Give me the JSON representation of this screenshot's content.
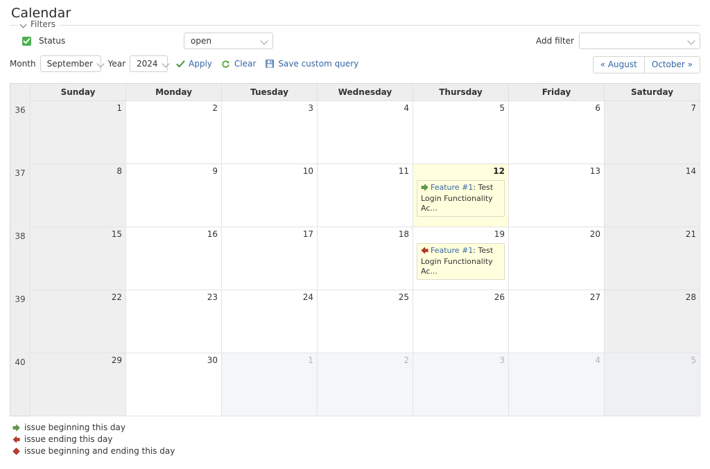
{
  "page": {
    "title": "Calendar"
  },
  "filters": {
    "legend": "Filters",
    "chevron_icon": "chevron-down-icon",
    "status": {
      "checked": true,
      "checkbox_icon": "checkmark-icon",
      "label": "Status",
      "value": "open",
      "caret_icon": "chevron-down-icon"
    },
    "add_filter": {
      "label": "Add filter",
      "value": "",
      "caret_icon": "chevron-down-icon"
    }
  },
  "controls": {
    "month_label": "Month",
    "month_value": "September",
    "year_label": "Year",
    "year_value": "2024",
    "apply": {
      "label": "Apply",
      "icon": "check-icon"
    },
    "clear": {
      "label": "Clear",
      "icon": "reload-icon"
    },
    "save": {
      "label": "Save custom query",
      "icon": "save-disk-icon"
    },
    "prev_month": "« August",
    "next_month": "October »"
  },
  "calendar": {
    "day_headers": [
      "Sunday",
      "Monday",
      "Tuesday",
      "Wednesday",
      "Thursday",
      "Friday",
      "Saturday"
    ],
    "weeks": [
      {
        "week_number": "36",
        "days": [
          {
            "num": "1",
            "weekend": true,
            "other_month": false,
            "today": false,
            "issues": []
          },
          {
            "num": "2",
            "weekend": false,
            "other_month": false,
            "today": false,
            "issues": []
          },
          {
            "num": "3",
            "weekend": false,
            "other_month": false,
            "today": false,
            "issues": []
          },
          {
            "num": "4",
            "weekend": false,
            "other_month": false,
            "today": false,
            "issues": []
          },
          {
            "num": "5",
            "weekend": false,
            "other_month": false,
            "today": false,
            "issues": []
          },
          {
            "num": "6",
            "weekend": false,
            "other_month": false,
            "today": false,
            "issues": []
          },
          {
            "num": "7",
            "weekend": true,
            "other_month": false,
            "today": false,
            "issues": []
          }
        ]
      },
      {
        "week_number": "37",
        "days": [
          {
            "num": "8",
            "weekend": true,
            "other_month": false,
            "today": false,
            "issues": []
          },
          {
            "num": "9",
            "weekend": false,
            "other_month": false,
            "today": false,
            "issues": []
          },
          {
            "num": "10",
            "weekend": false,
            "other_month": false,
            "today": false,
            "issues": []
          },
          {
            "num": "11",
            "weekend": false,
            "other_month": false,
            "today": false,
            "issues": []
          },
          {
            "num": "12",
            "weekend": false,
            "other_month": false,
            "today": true,
            "issues": [
              {
                "marker": "start",
                "marker_icon": "green-right-arrow-icon",
                "link": "Feature #1",
                "separator": ": ",
                "text": "Test Login Functionality Ac..."
              }
            ]
          },
          {
            "num": "13",
            "weekend": false,
            "other_month": false,
            "today": false,
            "issues": []
          },
          {
            "num": "14",
            "weekend": true,
            "other_month": false,
            "today": false,
            "issues": []
          }
        ]
      },
      {
        "week_number": "38",
        "days": [
          {
            "num": "15",
            "weekend": true,
            "other_month": false,
            "today": false,
            "issues": []
          },
          {
            "num": "16",
            "weekend": false,
            "other_month": false,
            "today": false,
            "issues": []
          },
          {
            "num": "17",
            "weekend": false,
            "other_month": false,
            "today": false,
            "issues": []
          },
          {
            "num": "18",
            "weekend": false,
            "other_month": false,
            "today": false,
            "issues": []
          },
          {
            "num": "19",
            "weekend": false,
            "other_month": false,
            "today": false,
            "issues": [
              {
                "marker": "end",
                "marker_icon": "red-left-arrow-icon",
                "link": "Feature #1",
                "separator": ": ",
                "text": "Test Login Functionality Ac..."
              }
            ]
          },
          {
            "num": "20",
            "weekend": false,
            "other_month": false,
            "today": false,
            "issues": []
          },
          {
            "num": "21",
            "weekend": true,
            "other_month": false,
            "today": false,
            "issues": []
          }
        ]
      },
      {
        "week_number": "39",
        "days": [
          {
            "num": "22",
            "weekend": true,
            "other_month": false,
            "today": false,
            "issues": []
          },
          {
            "num": "23",
            "weekend": false,
            "other_month": false,
            "today": false,
            "issues": []
          },
          {
            "num": "24",
            "weekend": false,
            "other_month": false,
            "today": false,
            "issues": []
          },
          {
            "num": "25",
            "weekend": false,
            "other_month": false,
            "today": false,
            "issues": []
          },
          {
            "num": "26",
            "weekend": false,
            "other_month": false,
            "today": false,
            "issues": []
          },
          {
            "num": "27",
            "weekend": false,
            "other_month": false,
            "today": false,
            "issues": []
          },
          {
            "num": "28",
            "weekend": true,
            "other_month": false,
            "today": false,
            "issues": []
          }
        ]
      },
      {
        "week_number": "40",
        "days": [
          {
            "num": "29",
            "weekend": true,
            "other_month": false,
            "today": false,
            "issues": []
          },
          {
            "num": "30",
            "weekend": false,
            "other_month": false,
            "today": false,
            "issues": []
          },
          {
            "num": "1",
            "weekend": false,
            "other_month": true,
            "today": false,
            "issues": []
          },
          {
            "num": "2",
            "weekend": false,
            "other_month": true,
            "today": false,
            "issues": []
          },
          {
            "num": "3",
            "weekend": false,
            "other_month": true,
            "today": false,
            "issues": []
          },
          {
            "num": "4",
            "weekend": false,
            "other_month": true,
            "today": false,
            "issues": []
          },
          {
            "num": "5",
            "weekend": true,
            "other_month": true,
            "today": false,
            "issues": []
          }
        ]
      }
    ]
  },
  "legend": [
    {
      "icon": "green-right-arrow-icon",
      "marker": "start",
      "label": "issue beginning this day"
    },
    {
      "icon": "red-left-arrow-icon",
      "marker": "end",
      "label": "issue ending this day"
    },
    {
      "icon": "red-diamond-icon",
      "marker": "both",
      "label": "issue beginning and ending this day"
    }
  ],
  "colors": {
    "link": "#3465a4",
    "accent_green": "#4caf50",
    "marker_start": "#5f9e45",
    "marker_end": "#c0392b",
    "today_bg": "#ffffdd",
    "weekend_bg": "#efefef",
    "othermonth_bg": "#f5f6f8",
    "header_bg": "#eeeeee"
  }
}
